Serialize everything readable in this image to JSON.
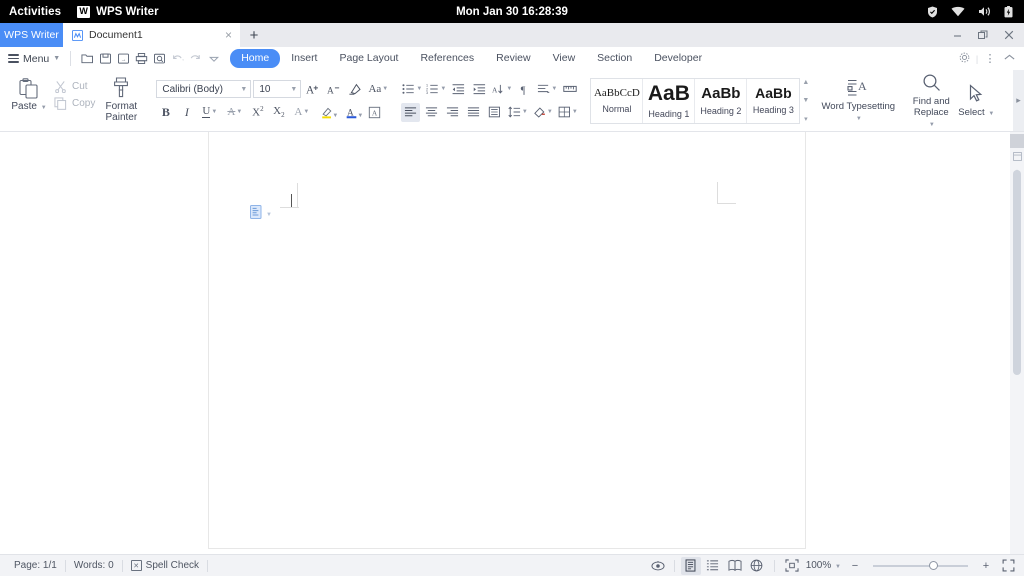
{
  "gnome": {
    "activities": "Activities",
    "app_name": "WPS Writer",
    "app_icon": "wps-writer-icon",
    "clock": "Mon Jan 30  16:28:39",
    "tray": [
      "shield-icon",
      "wifi-icon",
      "volume-icon",
      "battery-icon"
    ]
  },
  "tabbar": {
    "brand": "WPS Writer",
    "document_tab": {
      "label": "Document1",
      "icon": "document-icon",
      "close": "×"
    },
    "new_tab": "+",
    "window_controls": {
      "minimize": "─",
      "maximize": "❐",
      "close": "✕"
    }
  },
  "ribbon_tabs": {
    "menu_label": "Menu",
    "quick_access": [
      "open-icon",
      "save-icon",
      "save-as-icon",
      "print-icon",
      "print-preview-icon",
      "undo-icon",
      "redo-icon",
      "customize-icon"
    ],
    "tabs": [
      {
        "label": "Home",
        "active": true
      },
      {
        "label": "Insert",
        "active": false
      },
      {
        "label": "Page Layout",
        "active": false
      },
      {
        "label": "References",
        "active": false
      },
      {
        "label": "Review",
        "active": false
      },
      {
        "label": "View",
        "active": false
      },
      {
        "label": "Section",
        "active": false
      },
      {
        "label": "Developer",
        "active": false
      }
    ],
    "right_icons": [
      "gear-icon",
      "more-options-icon",
      "collapse-ribbon-icon"
    ]
  },
  "ribbon": {
    "clipboard": {
      "paste": "Paste",
      "cut": "Cut",
      "copy": "Copy",
      "format_painter_line1": "Format",
      "format_painter_line2": "Painter"
    },
    "font": {
      "name_value": "Calibri (Body)",
      "size_value": "10",
      "buttons": [
        "grow-font-icon",
        "shrink-font-icon",
        "clear-formatting-icon",
        "change-case-icon",
        "bold-icon",
        "italic-icon",
        "underline-icon",
        "strikethrough-icon",
        "superscript-icon",
        "subscript-icon",
        "text-effects-icon",
        "highlight-color-icon",
        "font-color-icon",
        "character-shading-icon"
      ]
    },
    "paragraph": {
      "buttons": [
        "bullets-icon",
        "numbering-icon",
        "decrease-indent-icon",
        "increase-indent-icon",
        "sort-icon",
        "show-formatting-marks-icon",
        "paragraph-layout-icon",
        "ruler-icon",
        "align-left-icon",
        "align-center-icon",
        "align-right-icon",
        "justify-icon",
        "distributed-icon",
        "line-spacing-icon",
        "shading-icon",
        "borders-icon"
      ]
    },
    "styles": [
      {
        "preview": "AaBbCcD",
        "name": "Normal",
        "size": 12
      },
      {
        "preview": "AaB",
        "name": "Heading 1",
        "size": 24
      },
      {
        "preview": "AaBb",
        "name": "Heading 2",
        "size": 17
      },
      {
        "preview": "AaBb",
        "name": "Heading 3",
        "size": 15
      }
    ],
    "word_typesetting": {
      "label": "Word Typesetting",
      "icon": "word-typesetting-icon"
    },
    "find_replace": {
      "line1": "Find and",
      "line2": "Replace",
      "icon": "search-icon"
    },
    "select": {
      "label": "Select",
      "icon": "cursor-arrow-icon"
    },
    "settings": {
      "label": "Settings",
      "icon": "settings-icon"
    }
  },
  "document": {
    "paste_options_icon": "paste-options-icon"
  },
  "status": {
    "page": "Page: 1/1",
    "words": "Words: 0",
    "spell_check": "Spell Check",
    "view_icons": [
      "read-mode-icon",
      "print-layout-icon",
      "outline-icon",
      "web-layout-icon",
      "full-screen-icon"
    ],
    "fit_icon": "fit-page-icon",
    "zoom": "100%",
    "zoom_out": "−",
    "zoom_in": "+",
    "fullscreen_icon": "expand-icon"
  },
  "colors": {
    "accent": "#4a8df6",
    "gnome_bar": "#000000",
    "tabbar_bg": "#e9eaee",
    "ribbon_bg": "#ffffff",
    "status_bg": "#f2f3f6",
    "page_bg": "#ffffff"
  }
}
